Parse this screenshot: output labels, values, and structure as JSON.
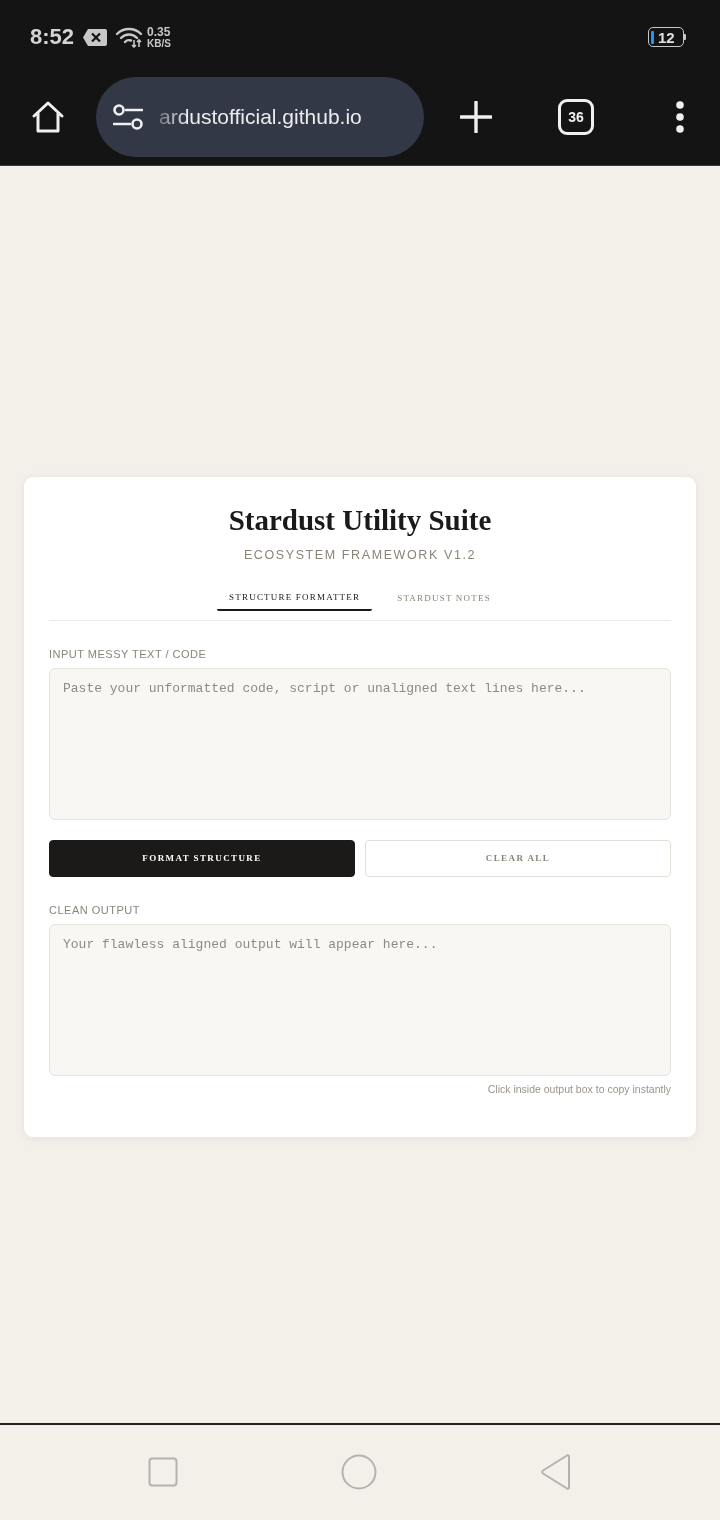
{
  "status_bar": {
    "time": "8:52",
    "net_speed_value": "0.35",
    "net_speed_unit": "KB/S",
    "battery": "12"
  },
  "browser": {
    "url": "ardustofficial.github.io",
    "tab_count": "36"
  },
  "app": {
    "title": "Stardust Utility Suite",
    "subtitle": "ECOSYSTEM FRAMEWORK V1.2",
    "tabs": [
      {
        "label": "STRUCTURE FORMATTER",
        "selected": true
      },
      {
        "label": "STARDUST NOTES",
        "selected": false
      }
    ],
    "input": {
      "label": "INPUT MESSY TEXT / CODE",
      "placeholder": "Paste your unformatted code, script or unaligned text lines here..."
    },
    "buttons": [
      {
        "label": "FORMAT STRUCTURE",
        "kind": "primary"
      },
      {
        "label": "CLEAR ALL",
        "kind": "secondary"
      }
    ],
    "output": {
      "label": "CLEAN OUTPUT",
      "placeholder": "Your flawless aligned output will appear here...",
      "hint": "Click inside output box to copy instantly"
    }
  }
}
